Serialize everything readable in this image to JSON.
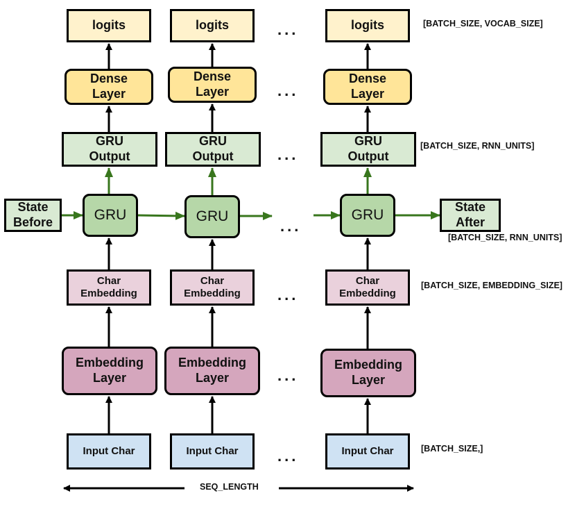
{
  "diagram": {
    "type": "unrolled-rnn-architecture",
    "colors": {
      "logits": "#fff2cc",
      "dense": "#ffe599",
      "gru_output": "#d9ead3",
      "gru": "#b6d7a8",
      "state": "#d9ead3",
      "char_embedding": "#ead1dc",
      "embedding_layer": "#d5a6bd",
      "input_char": "#cfe2f3",
      "recurrent_arrow": "#38761d",
      "feedforward_arrow": "#000000"
    },
    "columns": [
      {
        "logits": "logits",
        "dense": "Dense\nLayer",
        "gru_output": "GRU\nOutput",
        "gru": "GRU",
        "char_embedding": "Char\nEmbedding",
        "embedding_layer": "Embedding\nLayer",
        "input_char": "Input Char"
      },
      {
        "logits": "logits",
        "dense": "Dense\nLayer",
        "gru_output": "GRU\nOutput",
        "gru": "GRU",
        "char_embedding": "Char\nEmbedding",
        "embedding_layer": "Embedding\nLayer",
        "input_char": "Input Char"
      },
      {
        "logits": "logits",
        "dense": "Dense\nLayer",
        "gru_output": "GRU\nOutput",
        "gru": "GRU",
        "char_embedding": "Char\nEmbedding",
        "embedding_layer": "Embedding\nLayer",
        "input_char": "Input Char"
      }
    ],
    "state_before": "State\nBefore",
    "state_after": "State\nAfter",
    "ellipsis": "...",
    "shape_labels": {
      "logits": "[BATCH_SIZE, VOCAB_SIZE]",
      "gru_output": "[BATCH_SIZE, RNN_UNITS]",
      "state_after": "[BATCH_SIZE, RNN_UNITS]",
      "char_embedding": "[BATCH_SIZE, EMBEDDING_SIZE]",
      "input_char": "[BATCH_SIZE,]"
    },
    "seq_length_label": "SEQ_LENGTH"
  }
}
